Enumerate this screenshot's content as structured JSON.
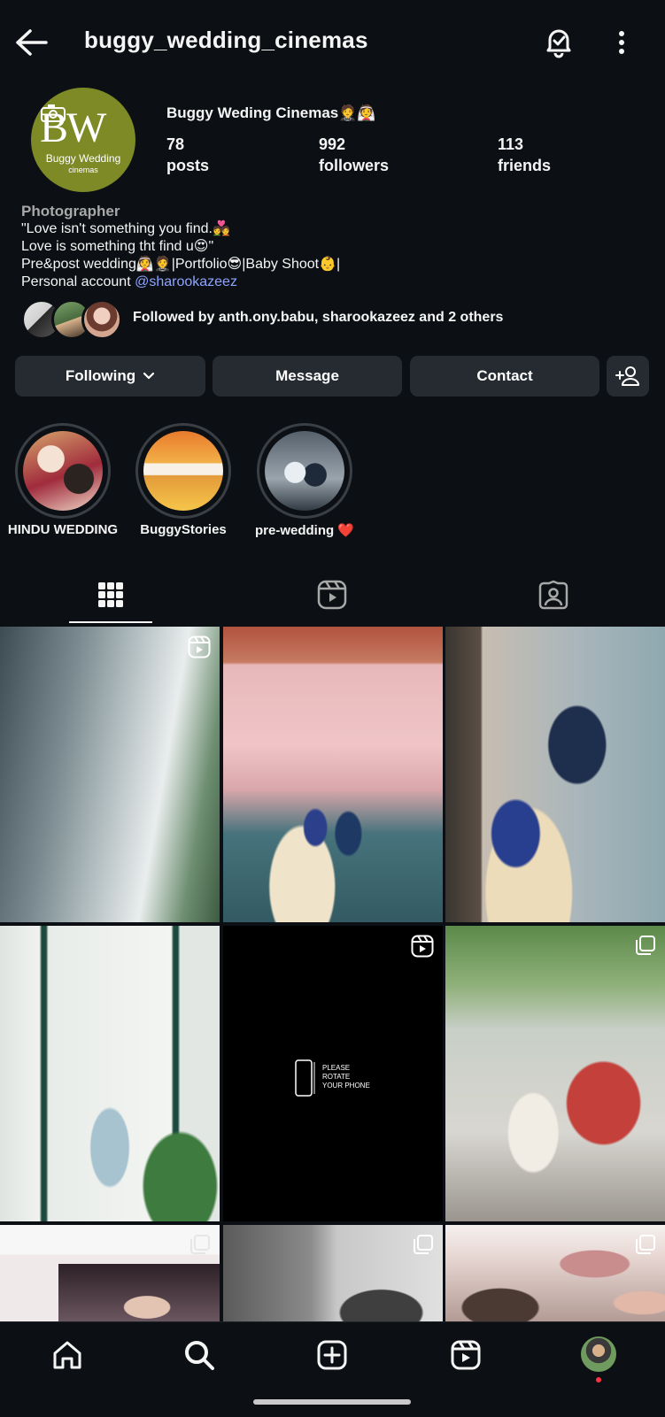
{
  "header": {
    "username": "buggy_wedding_cinemas",
    "back_icon": "arrow-left-icon",
    "notification_icon": "bell-check-icon",
    "menu_icon": "kebab-menu-icon"
  },
  "profile": {
    "display_name": "Buggy Weding Cinemas🤵👰",
    "avatar_logo": {
      "mark": "BW",
      "line1": "Buggy Wedding",
      "line2": "cinemas"
    },
    "stats": [
      {
        "value": "78",
        "label": "posts"
      },
      {
        "value": "992",
        "label": "followers"
      },
      {
        "value": "113",
        "label": "friends"
      }
    ]
  },
  "bio": {
    "category": "Photographer",
    "line1": "\"Love isn't something  you find.💑",
    "line2": " Love is something tht find u😍\"",
    "line3": " Pre&post wedding👰🤵|Portfolio😎|Baby Shoot👶|",
    "line4_prefix": "Personal  account ",
    "mention": "@sharookazeez"
  },
  "followed_by": {
    "text": "Followed by anth.ony.babu, sharookazeez and 2 others"
  },
  "actions": {
    "following_label": "Following",
    "message_label": "Message",
    "contact_label": "Contact",
    "add_friend_icon": "person-add-icon"
  },
  "highlights": [
    {
      "label": "HINDU WEDDING"
    },
    {
      "label": "BuggyStories"
    },
    {
      "label": "pre-wedding ❤️"
    }
  ],
  "tabs": [
    {
      "name": "grid",
      "icon": "grid-icon",
      "active": true
    },
    {
      "name": "reels",
      "icon": "reels-icon",
      "active": false
    },
    {
      "name": "tagged",
      "icon": "tagged-user-icon",
      "active": false
    }
  ],
  "grid_posts": [
    {
      "type": "reel",
      "badge": "reel-icon"
    },
    {
      "type": "photo"
    },
    {
      "type": "photo"
    },
    {
      "type": "photo"
    },
    {
      "type": "reel",
      "badge": "reel-icon",
      "overlay_text": [
        "PLEASE",
        "ROTATE",
        "YOUR PHONE"
      ]
    },
    {
      "type": "carousel",
      "badge": "carousel-icon"
    },
    {
      "type": "carousel",
      "badge": "carousel-icon"
    },
    {
      "type": "carousel",
      "badge": "carousel-icon"
    },
    {
      "type": "carousel",
      "badge": "carousel-icon"
    }
  ],
  "bottom_nav": [
    {
      "icon": "home-icon"
    },
    {
      "icon": "search-icon"
    },
    {
      "icon": "create-post-icon"
    },
    {
      "icon": "reels-icon"
    },
    {
      "icon": "profile-avatar"
    }
  ],
  "colors": {
    "background": "#0c1014",
    "button_bg": "#262b31",
    "mention": "#8ea4ff",
    "notification_dot": "#ff3040"
  }
}
